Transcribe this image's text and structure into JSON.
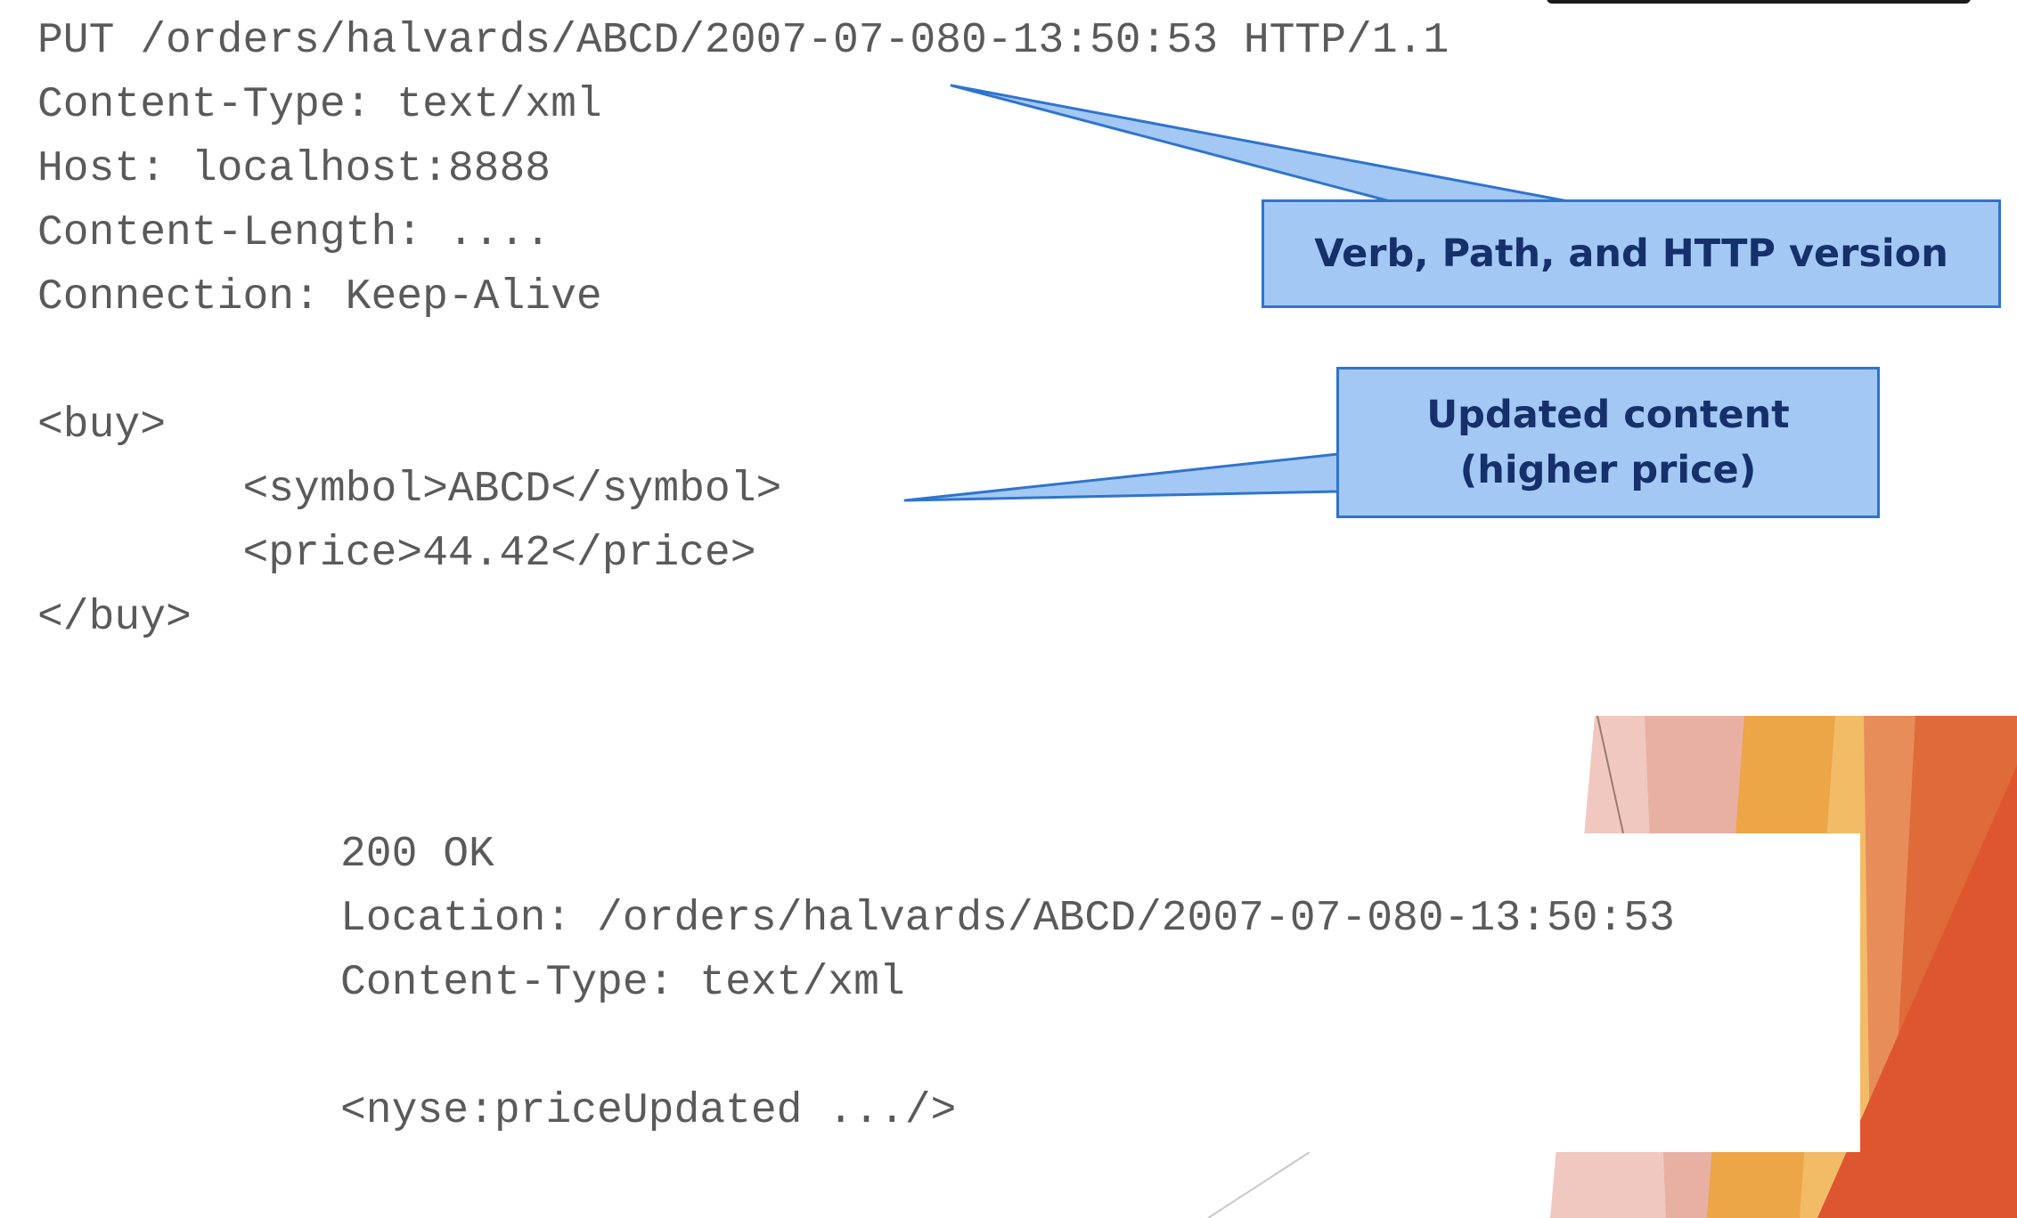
{
  "request": {
    "lines": [
      "PUT /orders/halvards/ABCD/2007-07-080-13:50:53 HTTP/1.1",
      "Content-Type: text/xml",
      "Host: localhost:8888",
      "Content-Length: ....",
      "Connection: Keep-Alive",
      "<buy>",
      "        <symbol>ABCD</symbol>",
      "        <price>44.42</price>",
      "</buy>"
    ]
  },
  "response": {
    "lines": [
      "200 OK",
      "Location: /orders/halvards/ABCD/2007-07-080-13:50:53",
      "Content-Type: text/xml",
      "<nyse:priceUpdated .../>"
    ]
  },
  "callouts": {
    "verb": "Verb, Path, and HTTP version",
    "content_line1": "Updated content",
    "content_line2": "(higher price)"
  },
  "colors": {
    "callout_fill": "#a4c8f4",
    "callout_border": "#2f74cc",
    "callout_text": "#15306a",
    "code_text": "#5a5a5a"
  }
}
